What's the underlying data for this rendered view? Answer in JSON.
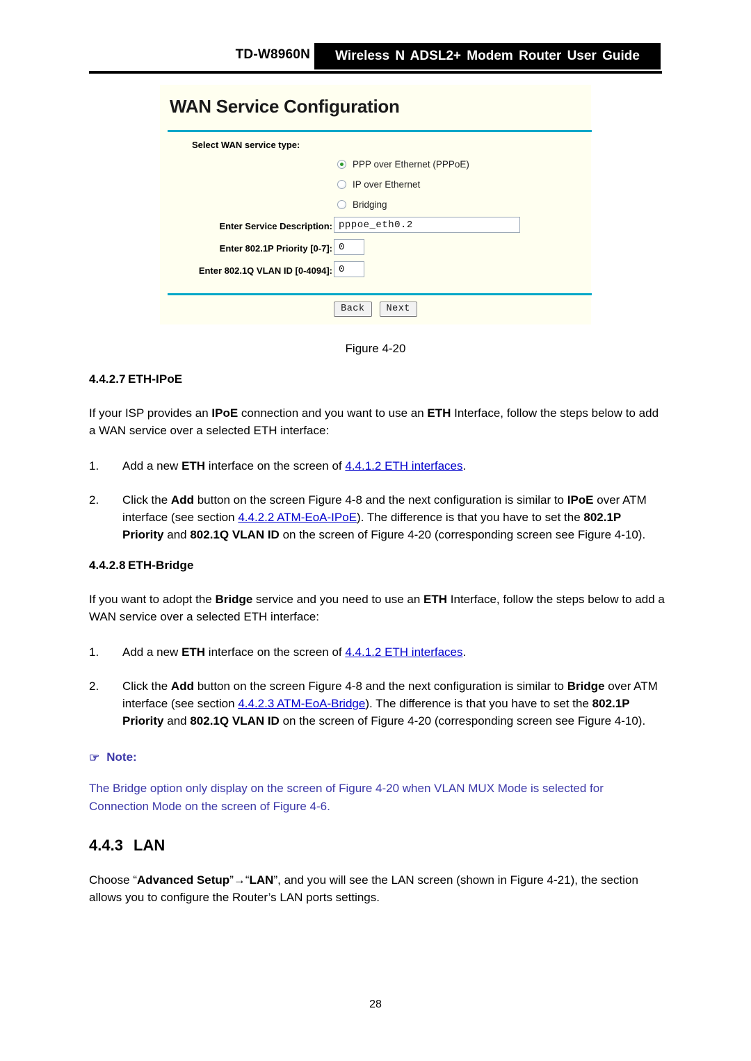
{
  "header": {
    "model": "TD-W8960N",
    "title": "Wireless N ADSL2+ Modem Router User Guide"
  },
  "screenshot": {
    "title": "WAN Service Configuration",
    "select_label": "Select WAN service type:",
    "radios": [
      {
        "label": "PPP over Ethernet (PPPoE)",
        "checked": true
      },
      {
        "label": "IP over Ethernet",
        "checked": false
      },
      {
        "label": "Bridging",
        "checked": false
      }
    ],
    "fields": [
      {
        "label": "Enter Service Description:",
        "value": "pppoe_eth0.2"
      },
      {
        "label": "Enter 802.1P Priority [0-7]:",
        "value": "0"
      },
      {
        "label": "Enter 802.1Q VLAN ID [0-4094]:",
        "value": "0"
      }
    ],
    "buttons": {
      "back": "Back",
      "next": "Next"
    },
    "accent_color": "#00a7c8",
    "panel_color": "#fffff0",
    "radio_dot_color": "#2e9b2e"
  },
  "figure_caption": "Figure 4-20",
  "sections": {
    "eth_ipoe": {
      "number": "4.4.2.7",
      "title": "ETH-IPoE",
      "intro_a": "If your ISP provides an ",
      "intro_b": "IPoE",
      "intro_c": " connection and you want to use an ",
      "intro_d": "ETH",
      "intro_e": " Interface, follow the steps below to add a WAN service over a selected ETH interface:",
      "step1": {
        "marker": "1.",
        "a": "Add a new ",
        "b": "ETH",
        "c": " interface on the screen of ",
        "link": "4.4.1.2 ETH interfaces",
        "d": "."
      },
      "step2": {
        "marker": "2.",
        "a": "Click the ",
        "b": "Add",
        "c": " button on the screen ",
        "d": "Figure 4-8",
        "e": " and the next configuration is similar to ",
        "f": "IPoE",
        "g": " over ATM interface (see section ",
        "link": "4.4.2.2 ATM-EoA-IPoE",
        "h": "). The difference is that you have to set the ",
        "i": "802.1P Priority",
        "j": " and ",
        "k": "802.1Q VLAN ID",
        "l": " on the screen of Figure 4-20 (corresponding screen see Figure 4-10)."
      }
    },
    "eth_bridge": {
      "number": "4.4.2.8",
      "title": "ETH-Bridge",
      "intro_a": "If you want to adopt the ",
      "intro_b": "Bridge",
      "intro_c": " service and you need to use an ",
      "intro_d": "ETH",
      "intro_e": " Interface, follow the steps below to add a WAN service over a selected ETH interface:",
      "step1": {
        "marker": "1.",
        "a": "Add a new ",
        "b": "ETH",
        "c": " interface on the screen of ",
        "link": "4.4.1.2 ETH interfaces",
        "d": "."
      },
      "step2": {
        "marker": "2.",
        "a": "Click the ",
        "b": "Add",
        "c": " button on the screen Figure 4-8 and the next configuration is similar to ",
        "f": "Bridge",
        "g": " over ATM interface (see section ",
        "link": "4.4.2.3 ATM-EoA-Bridge",
        "h": "). The difference is that you have to set the ",
        "i": "802.1P Priority",
        "j": " and ",
        "k": "802.1Q VLAN ID",
        "l": " on the screen of Figure 4-20 (corresponding screen see Figure 4-10)."
      }
    },
    "note": {
      "icon": "pointing-hand-icon",
      "icon_glyph": "☞",
      "title": "Note:",
      "text": "The Bridge option only display on the screen of Figure 4-20 when VLAN MUX Mode is selected for Connection Mode on the screen of Figure 4-6.",
      "color": "#3b37a8"
    },
    "lan": {
      "number": "4.4.3",
      "title": "LAN",
      "a": "Choose “",
      "b": "Advanced Setup",
      "c": "”→“",
      "d": "LAN",
      "e": "”, and you will see the LAN screen (shown in Figure 4-21), the section allows you to configure the Router’s LAN ports settings."
    }
  },
  "page_number": "28"
}
